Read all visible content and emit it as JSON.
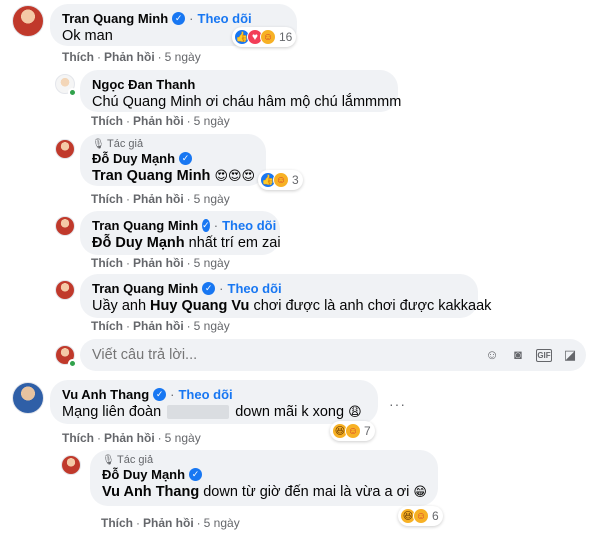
{
  "comments": [
    {
      "author": "Tran Quang Minh",
      "follow": "Theo dõi",
      "text": "Ok man",
      "like": "Thích",
      "reply": "Phản hồi",
      "time": "5 ngày",
      "reaction_count": "16",
      "reactions": [
        "like-icon",
        "love-icon",
        "care-icon"
      ]
    },
    {
      "author": "Ngọc Đan Thanh",
      "text": "Chú Quang Minh ơi cháu hâm mộ chú lắmmmm",
      "like": "Thích",
      "reply": "Phản hồi",
      "time": "5 ngày"
    },
    {
      "tag": "Tác giả",
      "author": "Đỗ Duy Mạnh",
      "mention": "Tran Quang Minh",
      "emojis": "😍😍😍",
      "like": "Thích",
      "reply": "Phản hồi",
      "time": "5 ngày",
      "reaction_count": "3",
      "reactions": [
        "like-icon",
        "care-icon"
      ]
    },
    {
      "author": "Tran Quang Minh",
      "follow": "Theo dõi",
      "mention": "Đỗ Duy Mạnh",
      "text": "nhất trí em zai",
      "like": "Thích",
      "reply": "Phản hồi",
      "time": "5 ngày"
    },
    {
      "author": "Tran Quang Minh",
      "follow": "Theo dõi",
      "text_before": "Uầy anh",
      "mention": "Huy Quang Vu",
      "text_after": "chơi được là anh chơi được kakkaak",
      "like": "Thích",
      "reply": "Phản hồi",
      "time": "5 ngày"
    },
    {
      "author": "Vu Anh Thang",
      "follow": "Theo dõi",
      "text_before": "Mạng liên đoàn",
      "text_after": "down mãi k xong",
      "emoji": "😩",
      "like": "Thích",
      "reply": "Phản hồi",
      "time": "5 ngày",
      "reaction_count": "7",
      "reactions": [
        "haha-icon",
        "care-icon"
      ]
    },
    {
      "tag": "Tác giả",
      "author": "Đỗ Duy Mạnh",
      "mention": "Vu Anh Thang",
      "text": "down từ giờ đến mai là vừa a ơi",
      "emoji": "😁",
      "like": "Thích",
      "reply": "Phản hồi",
      "time": "5 ngày",
      "reaction_count": "6",
      "reactions": [
        "haha-icon",
        "care-icon"
      ]
    }
  ],
  "reply_box": {
    "placeholder": "Viết câu trả lời...",
    "icons": [
      "emoji-icon",
      "camera-icon",
      "gif-icon",
      "sticker-icon"
    ]
  },
  "colors": {
    "link": "#1877f2",
    "bubble": "#f0f2f5",
    "muted": "#65676b"
  }
}
